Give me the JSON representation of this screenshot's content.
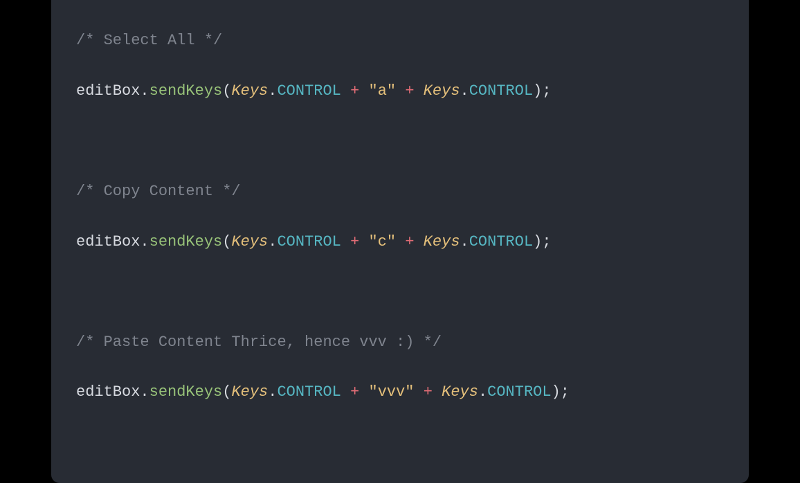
{
  "window": {
    "traffic_lights": {
      "red": "#ff5f56",
      "yellow": "#ffbd2e",
      "green": "#27c93f"
    }
  },
  "code": {
    "lines": [
      {
        "comment": "/* Select All */"
      },
      {
        "obj": "editBox",
        "dot1": ".",
        "method": "sendKeys",
        "open": "(",
        "class1": "Keys",
        "dot2": ".",
        "const1": "CONTROL",
        "sp1": " ",
        "op1": "+",
        "sp2": " ",
        "str": "\"a\"",
        "sp3": " ",
        "op2": "+",
        "sp4": " ",
        "class2": "Keys",
        "dot3": ".",
        "const2": "CONTROL",
        "close": ");"
      },
      {
        "blank": true
      },
      {
        "comment": "/* Copy Content */"
      },
      {
        "obj": "editBox",
        "dot1": ".",
        "method": "sendKeys",
        "open": "(",
        "class1": "Keys",
        "dot2": ".",
        "const1": "CONTROL",
        "sp1": " ",
        "op1": "+",
        "sp2": " ",
        "str": "\"c\"",
        "sp3": " ",
        "op2": "+",
        "sp4": " ",
        "class2": "Keys",
        "dot3": ".",
        "const2": "CONTROL",
        "close": ");"
      },
      {
        "blank": true
      },
      {
        "comment": "/* Paste Content Thrice, hence vvv :) */"
      },
      {
        "obj": "editBox",
        "dot1": ".",
        "method": "sendKeys",
        "open": "(",
        "class1": "Keys",
        "dot2": ".",
        "const1": "CONTROL",
        "sp1": " ",
        "op1": "+",
        "sp2": " ",
        "str": "\"vvv\"",
        "sp3": " ",
        "op2": "+",
        "sp4": " ",
        "class2": "Keys",
        "dot3": ".",
        "const2": "CONTROL",
        "close": ");"
      }
    ]
  }
}
